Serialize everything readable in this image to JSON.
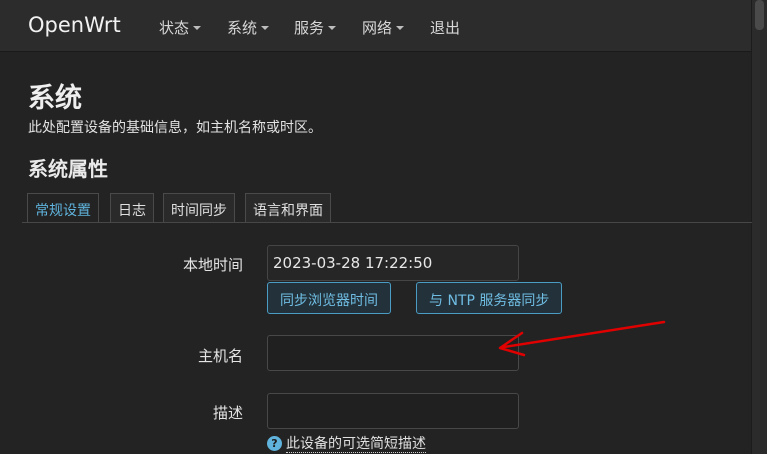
{
  "brand": "OpenWrt",
  "nav": {
    "items": [
      {
        "label": "状态",
        "dropdown": true
      },
      {
        "label": "系统",
        "dropdown": true
      },
      {
        "label": "服务",
        "dropdown": true
      },
      {
        "label": "网络",
        "dropdown": true
      },
      {
        "label": "退出",
        "dropdown": false
      }
    ]
  },
  "page": {
    "title": "系统",
    "description": "此处配置设备的基础信息，如主机名称或时区。"
  },
  "section": {
    "title": "系统属性",
    "tabs": [
      {
        "label": "常规设置",
        "active": true
      },
      {
        "label": "日志",
        "active": false
      },
      {
        "label": "时间同步",
        "active": false
      },
      {
        "label": "语言和界面",
        "active": false
      }
    ]
  },
  "form": {
    "local_time": {
      "label": "本地时间",
      "value": "2023-03-28 17:22:50",
      "sync_browser_button": "同步浏览器时间",
      "sync_ntp_button": "与 NTP 服务器同步"
    },
    "hostname": {
      "label": "主机名",
      "value": ""
    },
    "description": {
      "label": "描述",
      "value": "",
      "hint": "此设备的可选简短描述"
    }
  },
  "colors": {
    "background": "#232323",
    "navbar": "#2c2c2c",
    "accent": "#5fb3dc",
    "annotation_arrow": "#e00000"
  },
  "icons": {
    "help": "help-circle-icon",
    "dropdown": "caret-down-icon",
    "annotation": "red-arrow-annotation"
  }
}
